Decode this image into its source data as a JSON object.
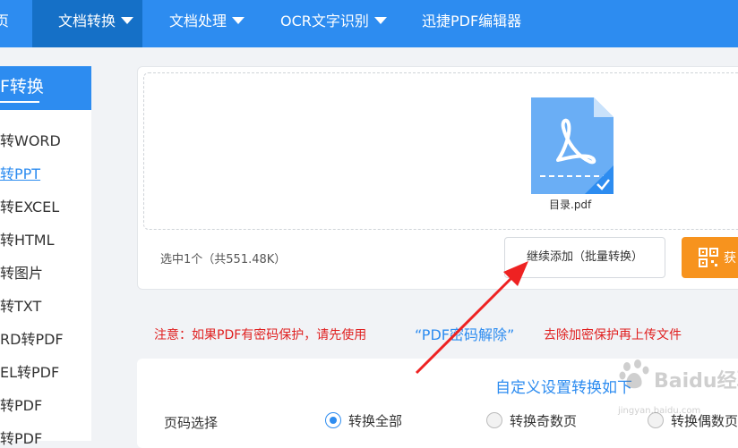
{
  "topnav": {
    "items": [
      {
        "label": "页"
      },
      {
        "label": "文档转换"
      },
      {
        "label": "文档处理"
      },
      {
        "label": "OCR文字识别"
      },
      {
        "label": "迅捷PDF编辑器"
      }
    ]
  },
  "sidebar": {
    "title": "F转换",
    "items": [
      {
        "label": "转WORD"
      },
      {
        "label": "转PPT"
      },
      {
        "label": "转EXCEL"
      },
      {
        "label": "转HTML"
      },
      {
        "label": "转图片"
      },
      {
        "label": "转TXT"
      },
      {
        "label": "RD转PDF"
      },
      {
        "label": "EL转PDF"
      },
      {
        "label": "转PDF"
      },
      {
        "label": "转PDF"
      }
    ]
  },
  "upload": {
    "file_name": "目录.pdf",
    "selected_info": "选中1个（共551.48K）",
    "continue_label": "继续添加（批量转换）",
    "convert_label": "获"
  },
  "notice": {
    "part1": "注意：如果PDF有密码保护，请先使用",
    "link": "“PDF密码解除”",
    "part2": "去除加密保护再上传文件"
  },
  "settings": {
    "title": "自定义设置转换如下",
    "page_label": "页码选择",
    "options": [
      {
        "label": "转换全部",
        "checked": true
      },
      {
        "label": "转换奇数页",
        "checked": false
      },
      {
        "label": "转换偶数页",
        "checked": false
      }
    ]
  },
  "watermark": {
    "brand": "Baidu经验",
    "url": "jingyan.baidu.com"
  },
  "colors": {
    "primary": "#2d8cf0",
    "primary_dark": "#1570c7",
    "accent": "#f7931e",
    "warning": "#e02020"
  }
}
